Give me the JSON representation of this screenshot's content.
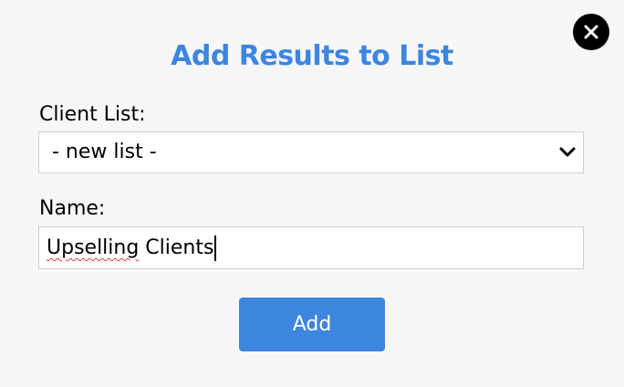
{
  "dialog": {
    "title": "Add Results to List",
    "close_icon": "close-icon",
    "client_list_label": "Client List:",
    "client_list_selected": "- new list -",
    "client_list_chevron_icon": "chevron-down-icon",
    "name_label": "Name:",
    "name_value": {
      "misspelled_part": "Upselling",
      "rest": " Clients"
    },
    "add_button_label": "Add"
  },
  "colors": {
    "accent": "#3d86e0",
    "background": "#f7f7f7",
    "spellcheck": "#e03c3c"
  }
}
